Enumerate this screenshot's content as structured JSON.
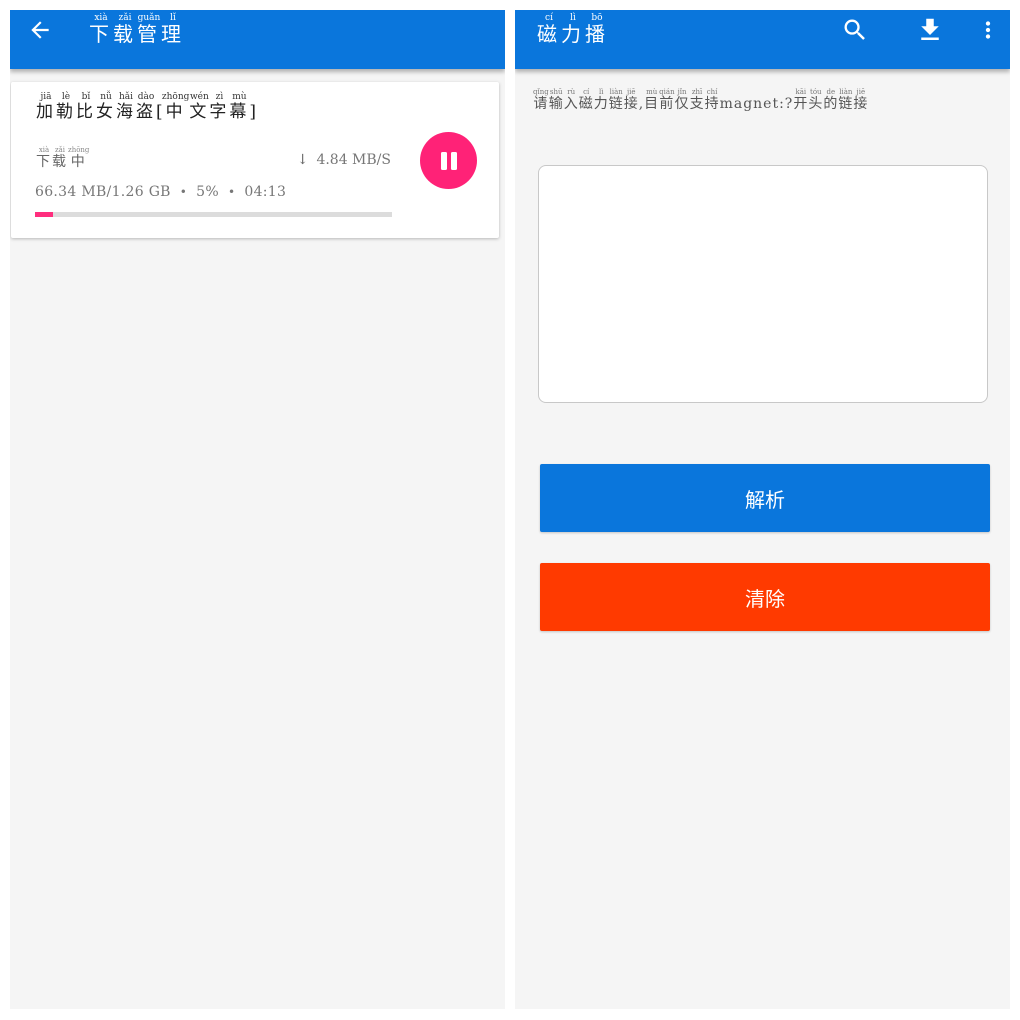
{
  "colors": {
    "app_bar": "#0a76dc",
    "accent_pink": "#ff2277",
    "parse_button": "#0a76dc",
    "clear_button": "#ff3a00",
    "background": "#f5f5f5"
  },
  "download_manager": {
    "back_icon": "arrow-left-icon",
    "title": "下载管理",
    "title_pinyin": [
      "xià",
      "zǎi",
      "guǎn",
      "lǐ"
    ],
    "task": {
      "name_main": "加勒比女海盗",
      "name_main_pinyin": [
        "jiā",
        "lè",
        "bǐ",
        "nǚ",
        "hǎi",
        "dào"
      ],
      "name_tag_open": "[",
      "name_tag": "中文字幕",
      "name_tag_pinyin": [
        "zhōng",
        "wén",
        "zì",
        "mù"
      ],
      "name_tag_close": "]",
      "status": "下载中",
      "status_pinyin": [
        "xià",
        "zǎi",
        "zhōng"
      ],
      "speed": "4.84 MB/S",
      "speed_icon": "arrow-down-icon",
      "size_progress": "66.34 MB/1.26 GB",
      "percent": "5%",
      "remaining_time": "04:13",
      "progress_fraction": 0.05,
      "action_icon": "pause-icon"
    }
  },
  "magnet_player": {
    "title": "磁力播",
    "title_pinyin": [
      "cí",
      "lì",
      "bō"
    ],
    "toolbar_icons": [
      "search-icon",
      "download-icon",
      "more-vert-icon"
    ],
    "hint": "请输入磁力链接,目前仅支持magnet:?开头的链接",
    "hint_pinyin_text": [
      "qǐng",
      "shū",
      "rù",
      "cí",
      "lì",
      "liàn",
      "jiē"
    ],
    "hint_pinyin_text2": [
      "mù",
      "qián",
      "jǐn",
      "zhī",
      "chí"
    ],
    "hint_pinyin_text3": [
      "kāi",
      "tóu",
      "de",
      "liàn",
      "jiē"
    ],
    "input_value": "",
    "parse_label": "解析",
    "clear_label": "清除"
  }
}
